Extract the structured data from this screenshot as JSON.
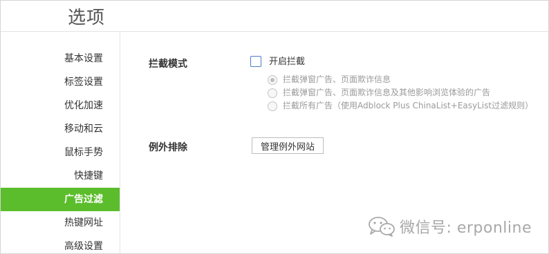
{
  "header": {
    "title": "选项"
  },
  "sidebar": {
    "items": [
      {
        "label": "基本设置",
        "active": false
      },
      {
        "label": "标签设置",
        "active": false
      },
      {
        "label": "优化加速",
        "active": false
      },
      {
        "label": "移动和云",
        "active": false
      },
      {
        "label": "鼠标手势",
        "active": false
      },
      {
        "label": "快捷键",
        "active": false
      },
      {
        "label": "广告过滤",
        "active": true
      },
      {
        "label": "热键网址",
        "active": false
      },
      {
        "label": "高级设置",
        "active": false
      }
    ],
    "active_color": "#5bbd2b"
  },
  "main": {
    "block_mode": {
      "label": "拦截模式",
      "checkbox_label": "开启拦截",
      "checked": false,
      "options": [
        {
          "label": "拦截弹窗广告、页面欺诈信息",
          "selected": true
        },
        {
          "label": "拦截弹窗广告、页面欺诈信息及其他影响浏览体验的广告",
          "selected": false
        },
        {
          "label": "拦截所有广告（使用Adblock Plus ChinaList+EasyList过滤规则）",
          "selected": false
        }
      ]
    },
    "exceptions": {
      "label": "例外排除",
      "button_label": "管理例外网站"
    }
  },
  "watermark": {
    "icon": "wechat-icon",
    "text": "微信号: erponline"
  }
}
